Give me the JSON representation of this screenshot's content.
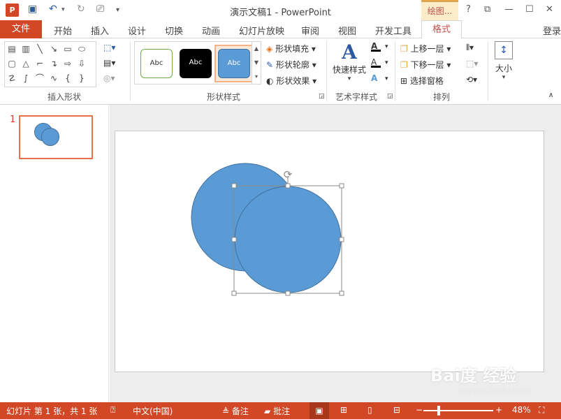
{
  "window": {
    "title": "演示文稿1 - PowerPoint",
    "context_tab_label": "绘图...",
    "help": "?",
    "restore_ribbon": "⧉",
    "minimize": "—",
    "maximize": "☐",
    "close": "✕"
  },
  "tabs": {
    "file": "文件",
    "items": [
      "开始",
      "插入",
      "设计",
      "切换",
      "动画",
      "幻灯片放映",
      "审阅",
      "视图",
      "开发工具"
    ],
    "active": "格式",
    "signin": "登录"
  },
  "ribbon": {
    "insert_shapes": {
      "label": "插入形状"
    },
    "shape_styles": {
      "label": "形状样式",
      "presets": [
        {
          "text": "Abc",
          "style": "outline-green"
        },
        {
          "text": "Abc",
          "style": "black"
        },
        {
          "text": "Abc",
          "style": "blue-selected"
        }
      ],
      "fill": "形状填充",
      "outline": "形状轮廓",
      "effects": "形状效果"
    },
    "wordart": {
      "label": "艺术字样式",
      "quick_styles": "快速样式"
    },
    "arrange": {
      "label": "排列",
      "bring_forward": "上移一层",
      "send_backward": "下移一层",
      "selection_pane": "选择窗格"
    },
    "size": {
      "label": "大小"
    }
  },
  "thumbnails": [
    {
      "number": "1"
    }
  ],
  "statusbar": {
    "slide_info": "幻灯片 第 1 张，共 1 张",
    "language": "中文(中国)",
    "notes": "备注",
    "comments": "批注",
    "zoom_minus": "−",
    "zoom_plus": "+",
    "zoom": "48%"
  },
  "colors": {
    "accent": "#d24726",
    "shape_fill": "#5b9bd5",
    "shape_outline": "#41719c",
    "context_tab_bg": "#fdecc8"
  },
  "watermark": {
    "text": "Bai度 经验",
    "subtext": "jingyan.baidu.com"
  }
}
